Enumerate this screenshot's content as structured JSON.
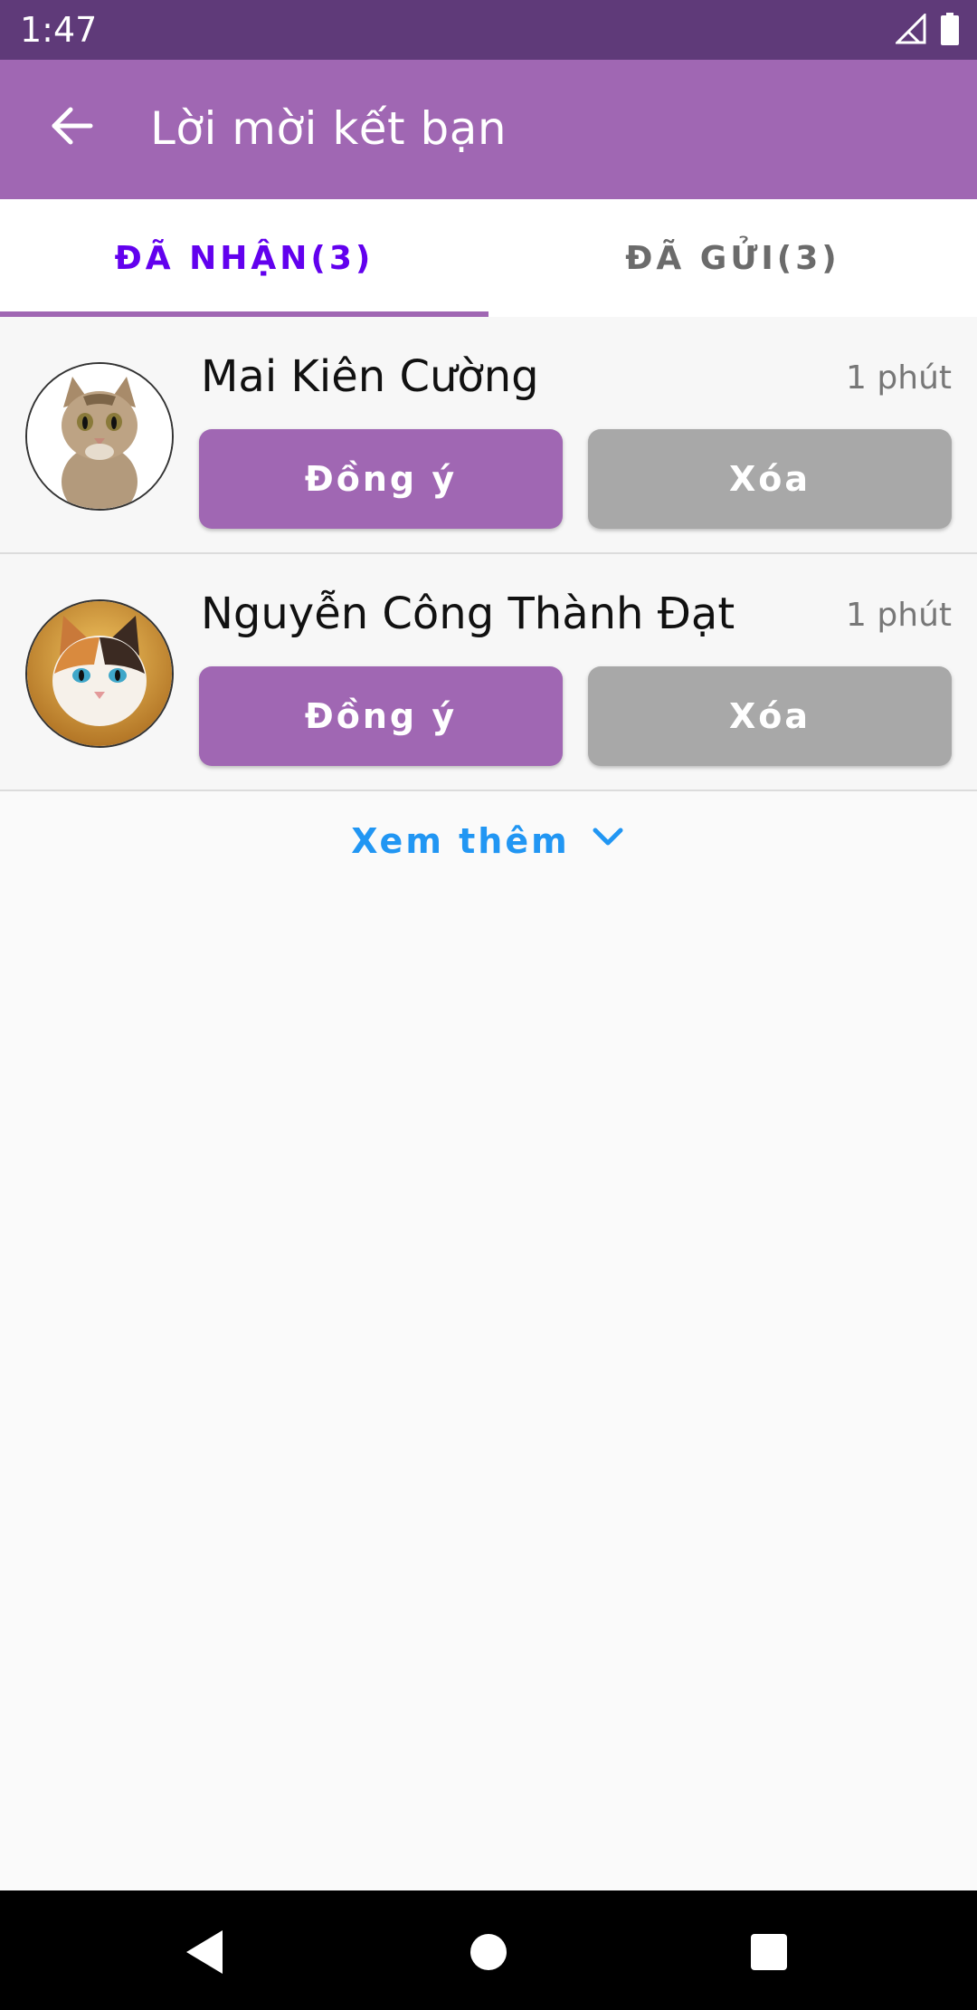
{
  "status_bar": {
    "time": "1:47",
    "icons": [
      "signal-icon",
      "battery-icon"
    ]
  },
  "app_bar": {
    "title": "Lời mời kết bạn",
    "back_icon": "arrow-back-icon"
  },
  "tabs": [
    {
      "label": "ĐÃ NHẬN(3)",
      "selected": true
    },
    {
      "label": "ĐÃ GỬI(3)",
      "selected": false
    }
  ],
  "requests": [
    {
      "name": "Mai Kiên Cường",
      "time": "1 phút",
      "accept_label": "Đồng ý",
      "delete_label": "Xóa",
      "avatar": "tabby-cat-avatar"
    },
    {
      "name": "Nguyễn Công Thành Đạt",
      "time": "1 phút",
      "accept_label": "Đồng ý",
      "delete_label": "Xóa",
      "avatar": "calico-cat-avatar"
    }
  ],
  "see_more": {
    "label": "Xem thêm",
    "icon": "chevron-down-icon"
  },
  "colors": {
    "status_bar": "#5f3a79",
    "app_bar": "#a067b3",
    "tab_selected": "#6200ee",
    "tab_unselected": "#6b6b6b",
    "accept_button": "#a067b3",
    "delete_button": "#a8a8a8",
    "link": "#2196f3"
  }
}
